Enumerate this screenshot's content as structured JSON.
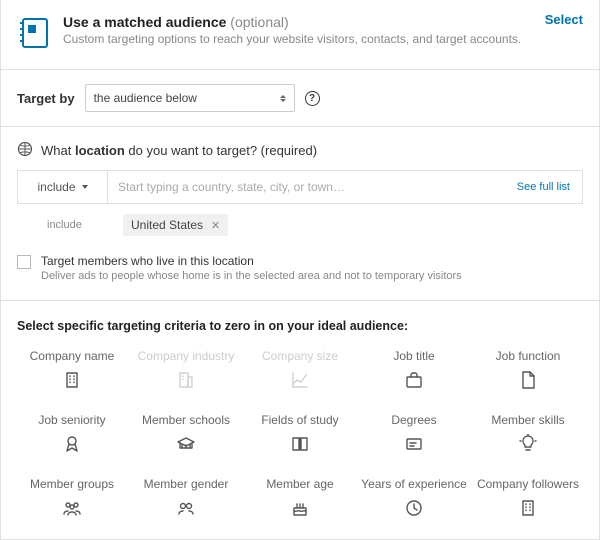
{
  "matched": {
    "title": "Use a matched audience",
    "optional": "(optional)",
    "subtitle": "Custom targeting options to reach your website visitors, contacts, and target accounts.",
    "select": "Select"
  },
  "target_by": {
    "label": "Target by",
    "value": "the audience below"
  },
  "location": {
    "question_pre": "What ",
    "question_bold": "location",
    "question_post": " do you want to target? (required)",
    "include": "include",
    "placeholder": "Start typing a country, state, city, or town…",
    "see_full": "See full list",
    "tags_label": "include",
    "tags": [
      "United States"
    ],
    "check_title": "Target members who live in this location",
    "check_sub": "Deliver ads to people whose home is in the selected area and not to temporary visitors"
  },
  "criteria": {
    "heading": "Select specific targeting criteria to zero in on your ideal audience:",
    "items": [
      {
        "label": "Company name",
        "icon": "building",
        "enabled": true
      },
      {
        "label": "Company industry",
        "icon": "industry",
        "enabled": false
      },
      {
        "label": "Company size",
        "icon": "chart",
        "enabled": false
      },
      {
        "label": "Job title",
        "icon": "briefcase",
        "enabled": true
      },
      {
        "label": "Job function",
        "icon": "document",
        "enabled": true
      },
      {
        "label": "Job seniority",
        "icon": "medal",
        "enabled": true
      },
      {
        "label": "Member schools",
        "icon": "school",
        "enabled": true
      },
      {
        "label": "Fields of study",
        "icon": "book",
        "enabled": true
      },
      {
        "label": "Degrees",
        "icon": "degree",
        "enabled": true
      },
      {
        "label": "Member skills",
        "icon": "bulb",
        "enabled": true
      },
      {
        "label": "Member groups",
        "icon": "group",
        "enabled": true
      },
      {
        "label": "Member gender",
        "icon": "gender",
        "enabled": true
      },
      {
        "label": "Member age",
        "icon": "cake",
        "enabled": true
      },
      {
        "label": "Years of experience",
        "icon": "clock",
        "enabled": true
      },
      {
        "label": "Company followers",
        "icon": "building",
        "enabled": true
      }
    ]
  }
}
